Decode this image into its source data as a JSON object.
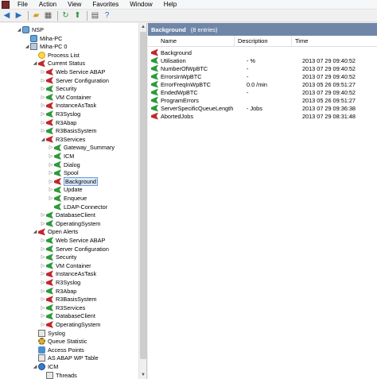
{
  "menubar": {
    "items": [
      "File",
      "Action",
      "View",
      "Favorites",
      "Window",
      "Help"
    ]
  },
  "toolbar": {
    "buttons": [
      "back-icon",
      "forward-icon",
      "folder-icon",
      "table-icon",
      "refresh-icon",
      "up-icon",
      "grid-icon",
      "help-icon"
    ]
  },
  "tree": [
    {
      "label": "NSP",
      "icon": "db",
      "level": 0,
      "exp": "◢"
    },
    {
      "label": "Miha-PC",
      "icon": "db",
      "level": 1,
      "exp": ""
    },
    {
      "label": "Miha-PC 0",
      "icon": "server",
      "level": 1,
      "exp": "◢"
    },
    {
      "label": "Process List",
      "icon": "sun",
      "level": 2,
      "exp": ""
    },
    {
      "label": "Current Status",
      "icon": "flag-r",
      "level": 2,
      "exp": "◢"
    },
    {
      "label": "Web Service ABAP",
      "icon": "flag-r",
      "level": 3,
      "exp": "▷"
    },
    {
      "label": "Server Configuration",
      "icon": "flag-r",
      "level": 3,
      "exp": "▷"
    },
    {
      "label": "Security",
      "icon": "flag-g",
      "level": 3,
      "exp": "▷"
    },
    {
      "label": "VM Container",
      "icon": "flag-g",
      "level": 3,
      "exp": "▷"
    },
    {
      "label": "InstanceAsTask",
      "icon": "flag-r",
      "level": 3,
      "exp": "▷"
    },
    {
      "label": "R3Syslog",
      "icon": "flag-g",
      "level": 3,
      "exp": "▷"
    },
    {
      "label": "R3Abap",
      "icon": "flag-r",
      "level": 3,
      "exp": "▷"
    },
    {
      "label": "R3BasisSystem",
      "icon": "flag-g",
      "level": 3,
      "exp": "▷"
    },
    {
      "label": "R3Services",
      "icon": "flag-r",
      "level": 3,
      "exp": "◢"
    },
    {
      "label": "Gateway_Summary",
      "icon": "flag-g",
      "level": 4,
      "exp": "▷"
    },
    {
      "label": "ICM",
      "icon": "flag-g",
      "level": 4,
      "exp": "▷"
    },
    {
      "label": "Dialog",
      "icon": "flag-g",
      "level": 4,
      "exp": "▷"
    },
    {
      "label": "Spool",
      "icon": "flag-g",
      "level": 4,
      "exp": "▷"
    },
    {
      "label": "Background",
      "icon": "flag-r",
      "level": 4,
      "exp": "▷",
      "selected": true
    },
    {
      "label": "Update",
      "icon": "flag-g",
      "level": 4,
      "exp": "▷"
    },
    {
      "label": "Enqueue",
      "icon": "flag-g",
      "level": 4,
      "exp": "▷"
    },
    {
      "label": "LDAP-Connector",
      "icon": "flag-g",
      "level": 4,
      "exp": ""
    },
    {
      "label": "DatabaseClient",
      "icon": "flag-g",
      "level": 3,
      "exp": "▷"
    },
    {
      "label": "OperatingSystem",
      "icon": "flag-g",
      "level": 3,
      "exp": "▷"
    },
    {
      "label": "Open Alerts",
      "icon": "flag-r",
      "level": 2,
      "exp": "◢"
    },
    {
      "label": "Web Service ABAP",
      "icon": "flag-g",
      "level": 3,
      "exp": "▷"
    },
    {
      "label": "Server Configuration",
      "icon": "flag-g",
      "level": 3,
      "exp": "▷"
    },
    {
      "label": "Security",
      "icon": "flag-g",
      "level": 3,
      "exp": "▷"
    },
    {
      "label": "VM Container",
      "icon": "flag-g",
      "level": 3,
      "exp": "▷"
    },
    {
      "label": "InstanceAsTask",
      "icon": "flag-r",
      "level": 3,
      "exp": "▷"
    },
    {
      "label": "R3Syslog",
      "icon": "flag-r",
      "level": 3,
      "exp": "▷"
    },
    {
      "label": "R3Abap",
      "icon": "flag-g",
      "level": 3,
      "exp": "▷"
    },
    {
      "label": "R3BasisSystem",
      "icon": "flag-r",
      "level": 3,
      "exp": "▷"
    },
    {
      "label": "R3Services",
      "icon": "flag-g",
      "level": 3,
      "exp": "▷"
    },
    {
      "label": "DatabaseClient",
      "icon": "flag-g",
      "level": 3,
      "exp": "▷"
    },
    {
      "label": "OperatingSystem",
      "icon": "flag-r",
      "level": 3,
      "exp": "▷"
    },
    {
      "label": "Syslog",
      "icon": "table",
      "level": 2,
      "exp": ""
    },
    {
      "label": "Queue Statistic",
      "icon": "gear",
      "level": 2,
      "exp": ""
    },
    {
      "label": "Access Points",
      "icon": "net",
      "level": 2,
      "exp": ""
    },
    {
      "label": "AS ABAP WP Table",
      "icon": "table",
      "level": 2,
      "exp": ""
    },
    {
      "label": "ICM",
      "icon": "globe",
      "level": 2,
      "exp": "◢"
    },
    {
      "label": "Threads",
      "icon": "table",
      "level": 3,
      "exp": ""
    }
  ],
  "panel": {
    "title": "Background",
    "count": "(8 entries)",
    "columns": [
      "Name",
      "Description",
      "Time"
    ],
    "rows": [
      {
        "name": "Background",
        "icon": "flag-r",
        "desc": "",
        "time": ""
      },
      {
        "name": "Utilisation",
        "icon": "flag-g",
        "desc": "- %",
        "time": "2013 07 29 09:40:52"
      },
      {
        "name": "NumberOfWpBTC",
        "icon": "flag-g",
        "desc": "-",
        "time": "2013 07 29 09:40:52"
      },
      {
        "name": "ErrorsInWpBTC",
        "icon": "flag-g",
        "desc": "-",
        "time": "2013 07 29 09:40:52"
      },
      {
        "name": "ErrorFreqInWpBTC",
        "icon": "flag-g",
        "desc": "0.0 /min",
        "time": "2013 05 26 09:51:27"
      },
      {
        "name": "EndedWpBTC",
        "icon": "flag-g",
        "desc": "-",
        "time": "2013 07 29 09:40:52"
      },
      {
        "name": "ProgramErrors",
        "icon": "flag-g",
        "desc": "",
        "time": "2013 05 26 09:51:27"
      },
      {
        "name": "ServerSpecificQueueLength",
        "icon": "flag-g",
        "desc": "- Jobs",
        "time": "2013 07 29 09:36:38"
      },
      {
        "name": "AbortedJobs",
        "icon": "flag-r",
        "desc": "",
        "time": "2013 07 29 08:31:48"
      }
    ]
  }
}
